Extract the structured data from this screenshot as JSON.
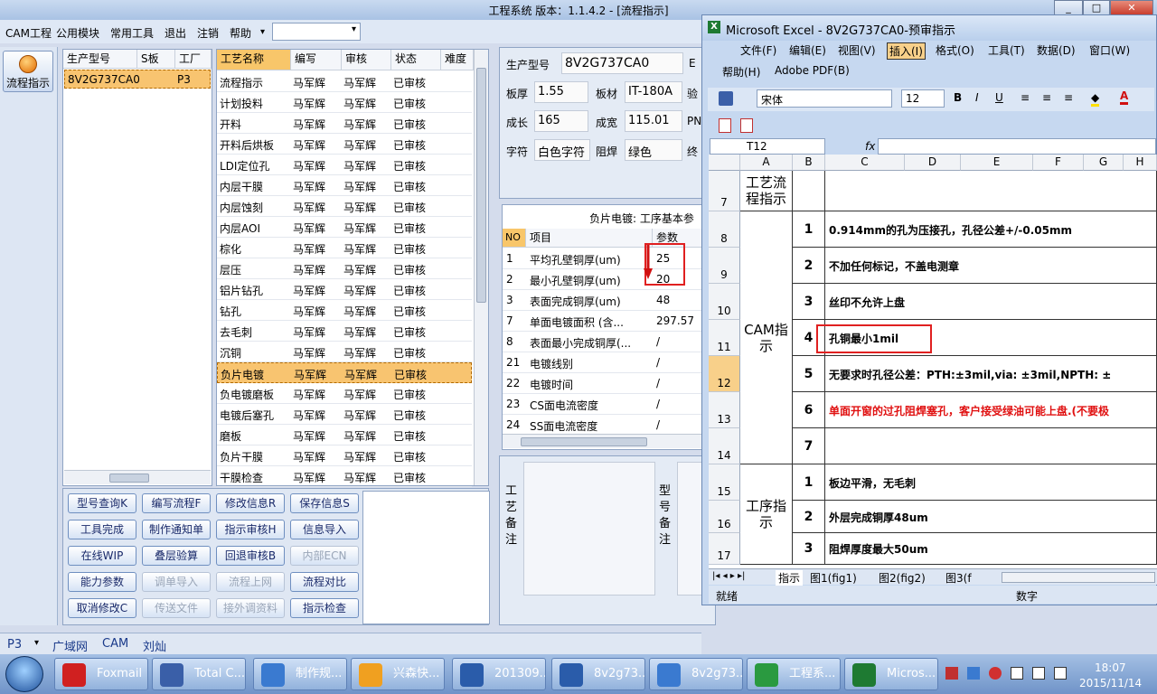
{
  "window": {
    "title": "工程系统  版本：1.1.4.2 - [流程指示]"
  },
  "menu": {
    "items": [
      "CAM工程",
      "公用模块",
      "常用工具",
      "退出",
      "注销",
      "帮助"
    ],
    "help_arrow": "▾",
    "combo_value": ""
  },
  "nav": {
    "flow_button": "流程指示"
  },
  "product_panel": {
    "headers": [
      "生产型号",
      "S板",
      "工厂"
    ],
    "rows": [
      {
        "model": "8V2G737CA0",
        "s": "",
        "factory": "P3"
      }
    ]
  },
  "process_panel": {
    "headers": [
      "工艺名称",
      "编写",
      "审核",
      "状态",
      "难度"
    ],
    "rows": [
      {
        "name": "流程指示",
        "author": "马军辉",
        "reviewer": "马军辉",
        "status": "已审核"
      },
      {
        "name": "计划投料",
        "author": "马军辉",
        "reviewer": "马军辉",
        "status": "已审核"
      },
      {
        "name": "开料",
        "author": "马军辉",
        "reviewer": "马军辉",
        "status": "已审核"
      },
      {
        "name": "开料后烘板",
        "author": "马军辉",
        "reviewer": "马军辉",
        "status": "已审核"
      },
      {
        "name": "LDI定位孔",
        "author": "马军辉",
        "reviewer": "马军辉",
        "status": "已审核"
      },
      {
        "name": "内层干膜",
        "author": "马军辉",
        "reviewer": "马军辉",
        "status": "已审核"
      },
      {
        "name": "内层蚀刻",
        "author": "马军辉",
        "reviewer": "马军辉",
        "status": "已审核"
      },
      {
        "name": "内层AOI",
        "author": "马军辉",
        "reviewer": "马军辉",
        "status": "已审核"
      },
      {
        "name": "棕化",
        "author": "马军辉",
        "reviewer": "马军辉",
        "status": "已审核"
      },
      {
        "name": "层压",
        "author": "马军辉",
        "reviewer": "马军辉",
        "status": "已审核"
      },
      {
        "name": "铝片钻孔",
        "author": "马军辉",
        "reviewer": "马军辉",
        "status": "已审核"
      },
      {
        "name": "钻孔",
        "author": "马军辉",
        "reviewer": "马军辉",
        "status": "已审核"
      },
      {
        "name": "去毛刺",
        "author": "马军辉",
        "reviewer": "马军辉",
        "status": "已审核"
      },
      {
        "name": "沉铜",
        "author": "马军辉",
        "reviewer": "马军辉",
        "status": "已审核"
      },
      {
        "name": "负片电镀",
        "author": "马军辉",
        "reviewer": "马军辉",
        "status": "已审核"
      },
      {
        "name": "负电镀磨板",
        "author": "马军辉",
        "reviewer": "马军辉",
        "status": "已审核"
      },
      {
        "name": "电镀后塞孔",
        "author": "马军辉",
        "reviewer": "马军辉",
        "status": "已审核"
      },
      {
        "name": "磨板",
        "author": "马军辉",
        "reviewer": "马军辉",
        "status": "已审核"
      },
      {
        "name": "负片干膜",
        "author": "马军辉",
        "reviewer": "马军辉",
        "status": "已审核"
      },
      {
        "name": "干膜检查",
        "author": "马军辉",
        "reviewer": "马军辉",
        "status": "已审核"
      }
    ]
  },
  "buttons": [
    {
      "label": "型号查询K",
      "enabled": true
    },
    {
      "label": "编写流程F",
      "enabled": true
    },
    {
      "label": "修改信息R",
      "enabled": true
    },
    {
      "label": "保存信息S",
      "enabled": true
    },
    {
      "label": "工具完成",
      "enabled": true
    },
    {
      "label": "制作通知单",
      "enabled": true
    },
    {
      "label": "指示审核H",
      "enabled": true
    },
    {
      "label": "信息导入",
      "enabled": true
    },
    {
      "label": "在线WIP",
      "enabled": true
    },
    {
      "label": "叠层验算",
      "enabled": true
    },
    {
      "label": "回退审核B",
      "enabled": true
    },
    {
      "label": "内部ECN",
      "enabled": false
    },
    {
      "label": "能力参数",
      "enabled": true
    },
    {
      "label": "调单导入",
      "enabled": false
    },
    {
      "label": "流程上网",
      "enabled": false
    },
    {
      "label": "流程对比",
      "enabled": true
    },
    {
      "label": "取消修改C",
      "enabled": true
    },
    {
      "label": "传送文件",
      "enabled": false
    },
    {
      "label": "接外调资料",
      "enabled": false
    },
    {
      "label": "指示检查",
      "enabled": true
    }
  ],
  "info": {
    "model_label": "生产型号",
    "model_value": "8V2G737CA0",
    "e_label": "E",
    "thickness_label": "板厚",
    "thickness_value": "1.55",
    "material_label": "板材",
    "material_value": "IT-180A",
    "verify_label": "验",
    "length_label": "成长",
    "length_value": "165",
    "width_label": "成宽",
    "width_value": "115.01",
    "pn_label": "PN",
    "char_label": "字符",
    "char_value": "白色字符",
    "mask_label": "阻焊",
    "mask_value": "绿色",
    "end_label": "终"
  },
  "params": {
    "title": "负片电镀: 工序基本参",
    "headers": [
      "NO",
      "项目",
      "参数"
    ],
    "rows": [
      {
        "no": "1",
        "item": "平均孔壁铜厚(um)",
        "value": "25"
      },
      {
        "no": "2",
        "item": "最小孔壁铜厚(um)",
        "value": "20"
      },
      {
        "no": "3",
        "item": "表面完成铜厚(um)",
        "value": "48"
      },
      {
        "no": "7",
        "item": "单面电镀面积 (含...",
        "value": "297.57"
      },
      {
        "no": "8",
        "item": "表面最小完成铜厚(...",
        "value": "/"
      },
      {
        "no": "21",
        "item": "电镀线别",
        "value": "/"
      },
      {
        "no": "22",
        "item": "电镀时间",
        "value": "/"
      },
      {
        "no": "23",
        "item": "CS面电流密度",
        "value": "/"
      },
      {
        "no": "24",
        "item": "SS面电流密度",
        "value": "/"
      }
    ]
  },
  "notes": {
    "process_label": "工艺备注",
    "model_label": "型号备注"
  },
  "statusbar": {
    "factory": "P3",
    "items": [
      "广域网",
      "CAM",
      "刘灿"
    ]
  },
  "excel": {
    "title": "Microsoft Excel - 8V2G737CA0-预审指示",
    "menu": [
      "文件(F)",
      "编辑(E)",
      "视图(V)",
      "插入(I)",
      "格式(O)",
      "工具(T)",
      "数据(D)",
      "窗口(W)",
      "帮助(H)",
      "Adobe PDF(B)"
    ],
    "font": "宋体",
    "size": "12",
    "namebox": "T12",
    "fx": "fx",
    "columns": [
      "A",
      "B",
      "C",
      "D",
      "E",
      "F",
      "G",
      "H"
    ],
    "rows": [
      {
        "num": "7",
        "a": "工艺流程指示",
        "b": "",
        "c": ""
      },
      {
        "num": "8",
        "a": "",
        "b": "1",
        "c": "0.914mm的孔为压接孔，孔径公差+/-0.05mm"
      },
      {
        "num": "9",
        "a": "",
        "b": "2",
        "c": "不加任何标记，不盖电测章"
      },
      {
        "num": "10",
        "a": "",
        "b": "3",
        "c": "丝印不允许上盘"
      },
      {
        "num": "11",
        "a": "CAM指示",
        "b": "4",
        "c": "孔铜最小1mil"
      },
      {
        "num": "12",
        "a": "",
        "b": "5",
        "c": "无要求时孔径公差：PTH:±3mil,via: ±3mil,NPTH: ±"
      },
      {
        "num": "13",
        "a": "",
        "b": "6",
        "c": "单面开窗的过孔阻焊塞孔，客户接受绿油可能上盘.(不要极"
      },
      {
        "num": "14",
        "a": "",
        "b": "7",
        "c": ""
      },
      {
        "num": "15",
        "a": "",
        "b": "1",
        "c": "板边平滑，无毛刺"
      },
      {
        "num": "16",
        "a": "",
        "b": "2",
        "c": "外层完成铜厚48um"
      },
      {
        "num": "17",
        "a": "工序指示",
        "b": "3",
        "c": "阻焊厚度最大50um"
      }
    ],
    "sheets": [
      "指示",
      "图1(fig1)",
      "图2(fig2)",
      "图3(f"
    ],
    "status_left": "就绪",
    "status_right": "数字"
  },
  "taskbar": {
    "tasks": [
      "Foxmail",
      "Total C...",
      "制作规...",
      "兴森快...",
      "201309...",
      "8v2g73...",
      "8v2g73...",
      "工程系...",
      "Micros..."
    ],
    "time": "18:07",
    "date": "2015/11/14"
  }
}
